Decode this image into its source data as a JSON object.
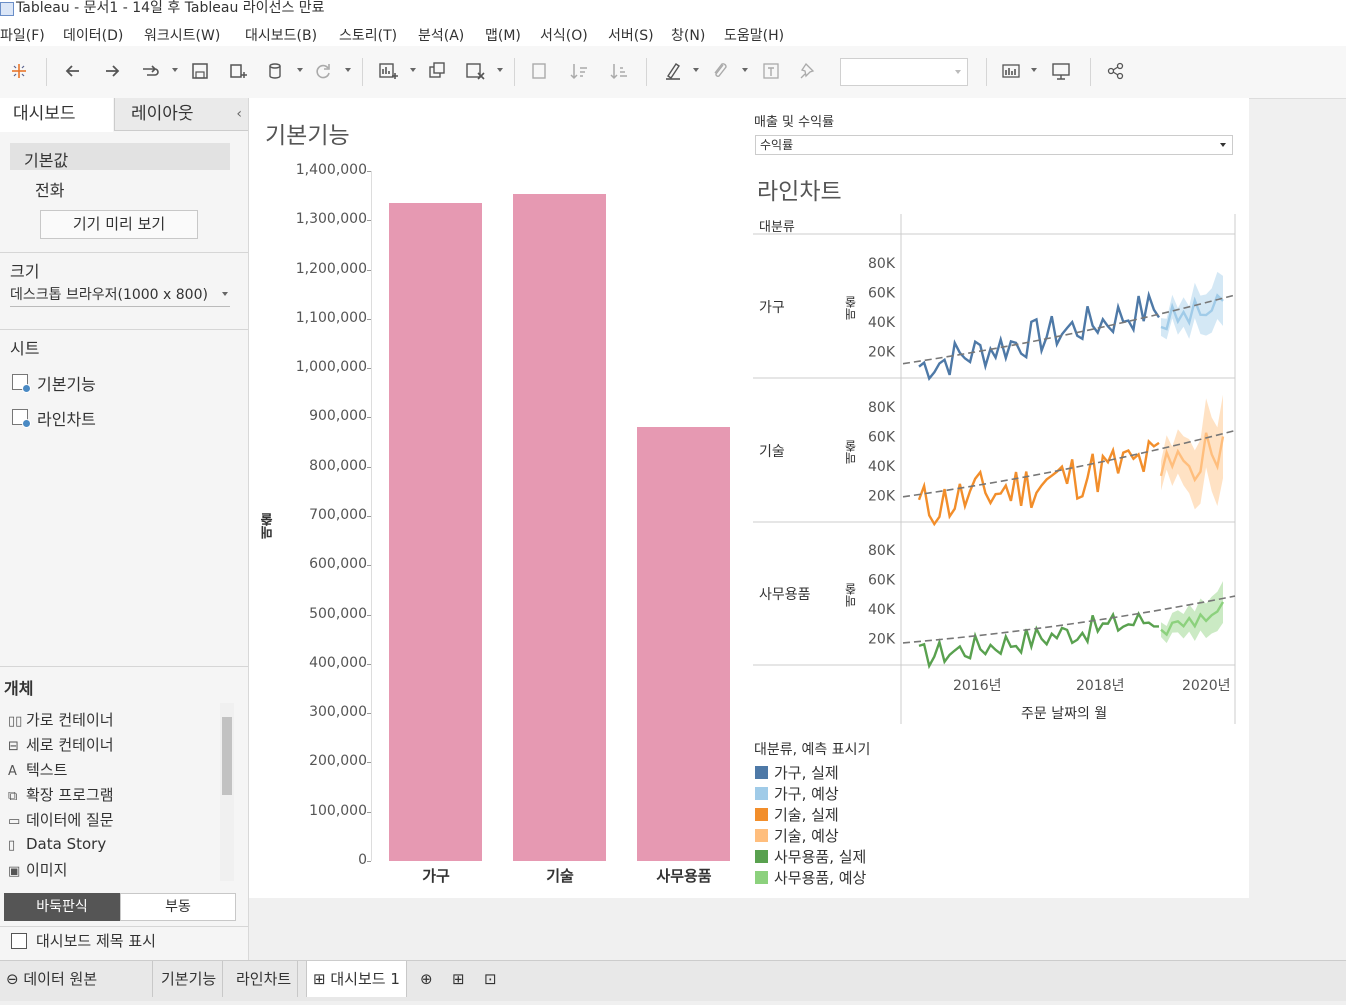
{
  "window": {
    "title": "Tableau - 문서1 - 14일 후 Tableau 라이선스 만료"
  },
  "menu": [
    "파일(F)",
    "데이터(D)",
    "워크시트(W)",
    "대시보드(B)",
    "스토리(T)",
    "분석(A)",
    "맵(M)",
    "서식(O)",
    "서버(S)",
    "창(N)",
    "도움말(H)"
  ],
  "toolbar": {
    "icons": [
      "tableau-logo-icon",
      "undo-icon",
      "redo-icon",
      "replay-icon",
      "save-icon",
      "new-datasource-icon",
      "pause-updates-icon",
      "refresh-icon",
      "new-worksheet-icon",
      "duplicate-sheet-icon",
      "clear-sheet-icon",
      "swap-icon",
      "sort-asc-icon",
      "sort-desc-icon",
      "highlight-icon",
      "group-icon",
      "labels-icon",
      "pin-icon",
      "show-me-icon",
      "presentation-icon",
      "share-icon"
    ],
    "fit_value": ""
  },
  "left_panel": {
    "tabs": [
      "대시보드",
      "레이아웃"
    ],
    "device": {
      "default": "기본값",
      "phone": "전화",
      "preview_button": "기기 미리 보기"
    },
    "size": {
      "title": "크기",
      "value": "데스크톱 브라우저(1000 x 800)"
    },
    "sheets": {
      "title": "시트",
      "items": [
        "기본기능",
        "라인차트"
      ]
    },
    "objects": {
      "title": "개체",
      "items": [
        {
          "icon": "horizontal-container-icon",
          "label": "가로 컨테이너"
        },
        {
          "icon": "vertical-container-icon",
          "label": "세로 컨테이너"
        },
        {
          "icon": "text-icon",
          "label": "텍스트"
        },
        {
          "icon": "extension-icon",
          "label": "확장 프로그램"
        },
        {
          "icon": "ask-data-icon",
          "label": "데이터에 질문"
        },
        {
          "icon": "data-story-icon",
          "label": "Data Story"
        },
        {
          "icon": "image-icon",
          "label": "이미지"
        }
      ],
      "tiled": "바둑판식",
      "floating": "부동"
    },
    "show_title": {
      "label": "대시보드 제목 표시",
      "checked": false
    }
  },
  "dashboard": {
    "bar_sheet_title": "기본기능",
    "line_sheet_title": "라인차트",
    "parameter": {
      "label": "매출 및 수익률",
      "value": "수익률"
    },
    "line_chart": {
      "row_header": "대분류",
      "ylabel": "매출",
      "xlabel": "주문 날짜의 월",
      "x_ticks": [
        "2016년",
        "2018년",
        "2020년"
      ],
      "y_ticks": [
        "80K",
        "60K",
        "40K",
        "20K"
      ],
      "panes": [
        "가구",
        "기술",
        "사무용품"
      ]
    },
    "legend": {
      "title": "대분류, 예측 표시기",
      "items": [
        {
          "label": "가구, 실제",
          "color": "#4e79a7"
        },
        {
          "label": "가구, 예상",
          "color": "#a0cbe8"
        },
        {
          "label": "기술, 실제",
          "color": "#f28e2b"
        },
        {
          "label": "기술, 예상",
          "color": "#ffbe7d"
        },
        {
          "label": "사무용품, 실제",
          "color": "#59a14f"
        },
        {
          "label": "사무용품, 예상",
          "color": "#8cd17d"
        }
      ]
    }
  },
  "chart_data": {
    "type": "bar",
    "categories": [
      "가구",
      "기술",
      "사무용품"
    ],
    "values": [
      1336000,
      1353000,
      880000
    ],
    "ylabel": "매출",
    "ylim": [
      0,
      1400000
    ],
    "y_ticks": [
      "1,400,000",
      "1,300,000",
      "1,200,000",
      "1,100,000",
      "1,000,000",
      "900,000",
      "800,000",
      "700,000",
      "600,000",
      "500,000",
      "400,000",
      "300,000",
      "200,000",
      "100,000",
      "0"
    ],
    "color": "#e699b2"
  },
  "sheet_tabs": {
    "datasource": "데이터 원본",
    "tabs": [
      "기본기능",
      "라인차트",
      "대시보드 1"
    ],
    "active": "대시보드 1"
  }
}
